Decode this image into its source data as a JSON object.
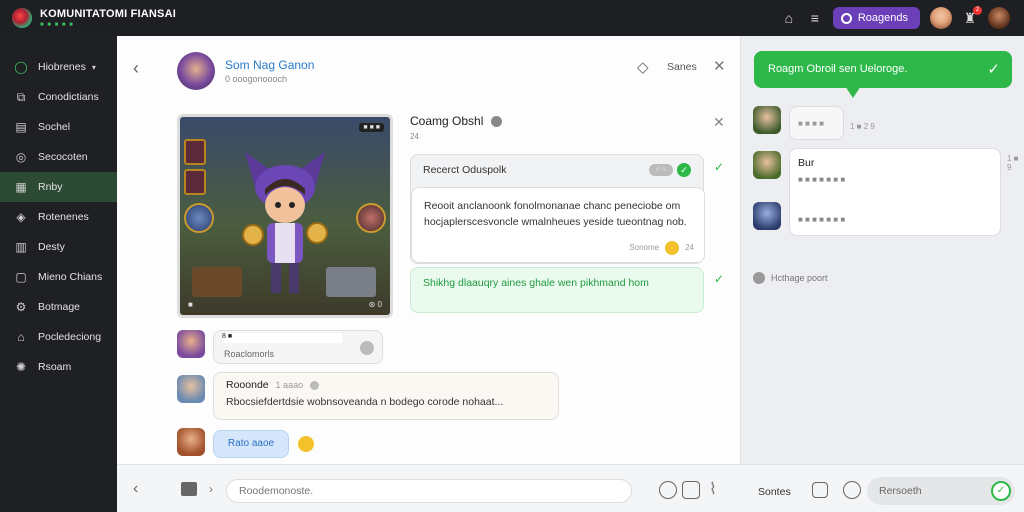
{
  "app": {
    "title": "KOMUNITATOMI FIANSAI",
    "subtitle": "■ ■ ■ ■ ■"
  },
  "topbar": {
    "pill_label": "Roagends",
    "badge": "2",
    "icons": [
      "home-icon",
      "trophy-icon"
    ]
  },
  "sidebar": {
    "items": [
      {
        "label": "Hiobrenes",
        "icon": "globe-icon",
        "caret": "▾"
      },
      {
        "label": "Conodictians",
        "icon": "controller-icon"
      },
      {
        "label": "Sochel",
        "icon": "book-icon"
      },
      {
        "label": "Secocoten",
        "icon": "globe-icon"
      },
      {
        "label": "Rnby",
        "icon": "grid-icon",
        "active": true
      },
      {
        "label": "Rotenenes",
        "icon": "chat-icon"
      },
      {
        "label": "Desty",
        "icon": "calendar-icon"
      },
      {
        "label": "Mieno Chians",
        "icon": "square-icon"
      },
      {
        "label": "Botmage",
        "icon": "settings-icon"
      },
      {
        "label": "Pocledeciong",
        "icon": "house-icon"
      },
      {
        "label": "Rsoam",
        "icon": "world-icon"
      }
    ]
  },
  "chat": {
    "name": "Som Nag Ganon",
    "status": "0 ooogonoooch",
    "header_label": "Sanes",
    "game_card": {
      "tag": "■ ■ ■",
      "foot_left": "■",
      "foot_right": "⊛ 0"
    },
    "group": {
      "title": "Coamg Obshl",
      "count": "24",
      "row1_label": "Recerct Oduspolk",
      "row1_pill": "○ ○",
      "body": "Reooit anclanoonk fonolmonanae chanc peneciobe om hocjaplerscesvoncle wmalnheues yeside tueontnag nob.",
      "body_meta": "Sonome",
      "body_meta2": "24",
      "green_msg": "Shikhg dlaauqry aines ghale wen pikhmand hom"
    },
    "reply": {
      "name": "8 ■",
      "text": "Roaclomorls"
    },
    "msg3": {
      "name": "Rooonde",
      "time": "1 aaao",
      "body": "Rbocsiefdertdsie wobnsoveanda n bodego corode nohaat..."
    },
    "blue_pill": "Rato aaoe"
  },
  "composer": {
    "placeholder": "Roodemonoste.",
    "label": "Sontes",
    "send_label": "Rersoeth"
  },
  "right_panel": {
    "toast": "Roagm Obroil sen Ueloroge.",
    "small_text": "■ ■ ■ ■",
    "small_meta": "1 ■ 2 9",
    "bubble_title": "Bur",
    "bubble_line1": "■ ■ ■ ■ ■ ■ ■",
    "bubble_line2": "■ ■ ■ ■ ■ ■ ■",
    "bubble_meta": "1 ■ 9",
    "foot": "Hcthage poort"
  },
  "colors": {
    "accent": "#2eb84a",
    "purple": "#6a3fb8",
    "sidebar_bg": "#1f2023",
    "topbar_bg": "#1e1f22"
  }
}
